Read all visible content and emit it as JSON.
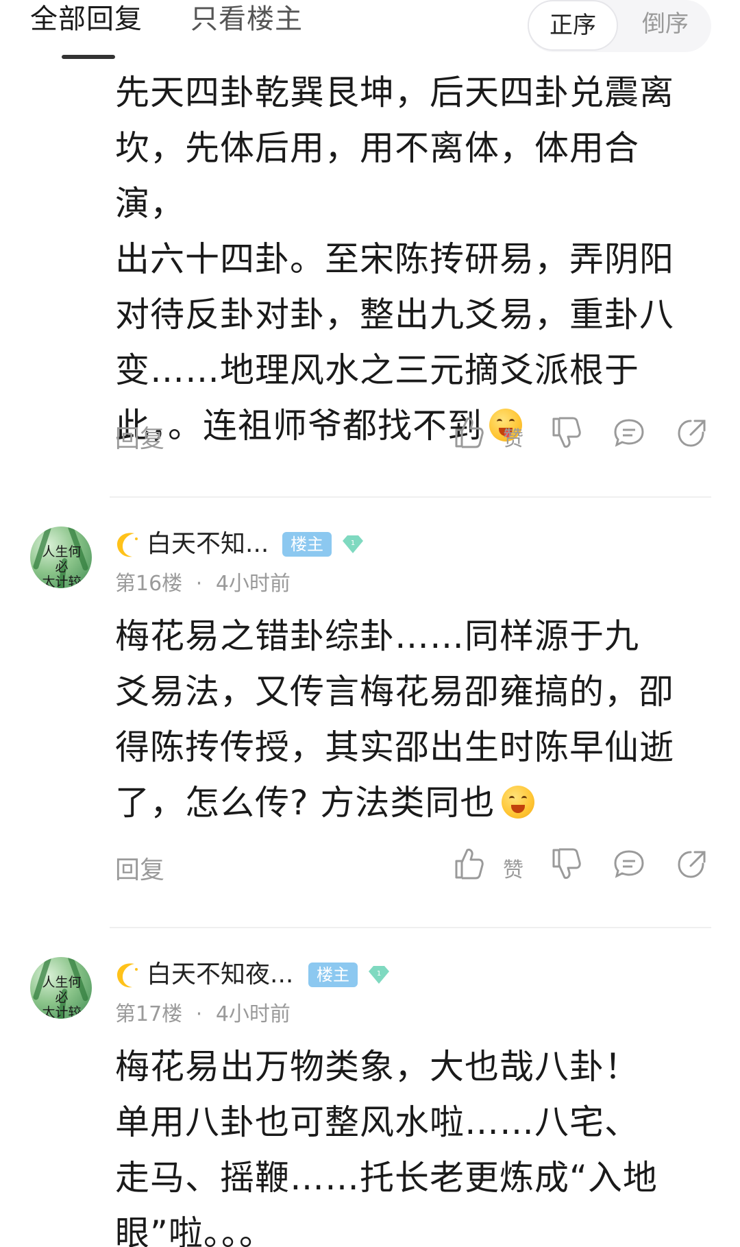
{
  "tabs": {
    "all": "全部回复",
    "owner_only": "只看楼主",
    "sort_asc": "正序",
    "sort_desc": "倒序"
  },
  "posts": [
    {
      "lines": [
        "先天四卦乾巽艮坤，后天四卦兑震离",
        "坎，先体后用，用不离体，体用合演，",
        "出六十四卦。至宋陈抟研易，弄阴阳",
        "对待反卦对卦，整出九爻易，重卦八",
        "变……地理风水之三元摘爻派根于",
        "此，。连祖师爷都找不到"
      ],
      "emoji": "yum-face",
      "actions": {
        "reply": "回复",
        "like": "赞"
      }
    },
    {
      "user": {
        "name": "白天不知...",
        "badge": "楼主",
        "level": "1",
        "floor": "第16楼",
        "sep": "·",
        "time": "4小时前"
      },
      "lines": [
        "梅花易之错卦综卦……同样源于九",
        "爻易法，又传言梅花易卲雍搞的，卲",
        "得陈抟传授，其实邵出生时陈早仙逝",
        "了，怎么传? 方法类同也"
      ],
      "emoji": "grin-face",
      "actions": {
        "reply": "回复",
        "like": "赞"
      }
    },
    {
      "user": {
        "name": "白天不知夜...",
        "badge": "楼主",
        "level": "1",
        "floor": "第17楼",
        "sep": "·",
        "time": "4小时前"
      },
      "lines": [
        "梅花易出万物类象，大也哉八卦！",
        "单用八卦也可整风水啦……八宅、",
        "走马、摇鞭……托长老更炼成“入地",
        "眼”啦。。。"
      ]
    }
  ],
  "colors": {
    "text": "#1a1a1a",
    "muted": "#9a9a9a",
    "badge": "#8cc8f0",
    "divider": "#efefef"
  },
  "icons": [
    "thumb-up-icon",
    "thumb-down-icon",
    "comment-icon",
    "share-icon",
    "moon-icon",
    "diamond-icon"
  ]
}
